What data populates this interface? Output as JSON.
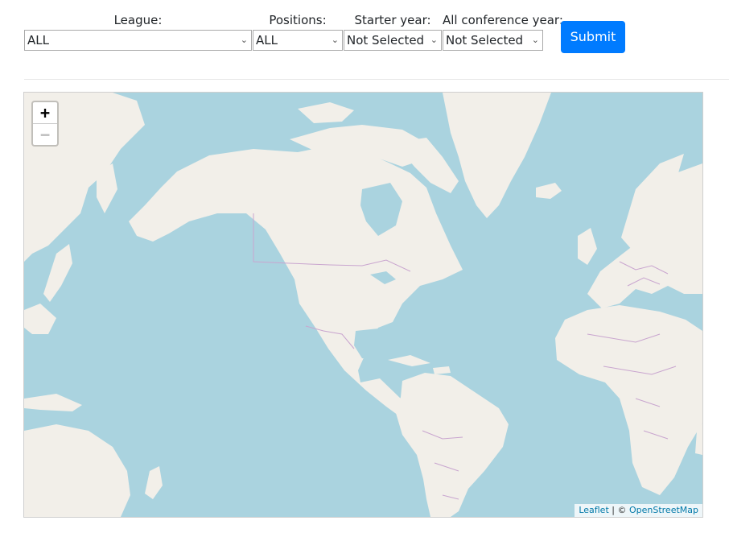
{
  "filters": {
    "league": {
      "label": "League:",
      "value": "ALL"
    },
    "positions": {
      "label": "Positions:",
      "value": "ALL"
    },
    "starter_year": {
      "label": "Starter year:",
      "value": "Not Selected"
    },
    "all_conference_year": {
      "label": "All conference year:",
      "value": "Not Selected"
    },
    "submit_label": "Submit"
  },
  "map": {
    "zoom_in_label": "+",
    "zoom_out_label": "−",
    "attribution": {
      "leaflet": "Leaflet",
      "separator": " | © ",
      "osm": "OpenStreetMap"
    },
    "colors": {
      "water": "#aad3df",
      "land": "#f2efe9",
      "border": "#c9a5cf"
    }
  }
}
